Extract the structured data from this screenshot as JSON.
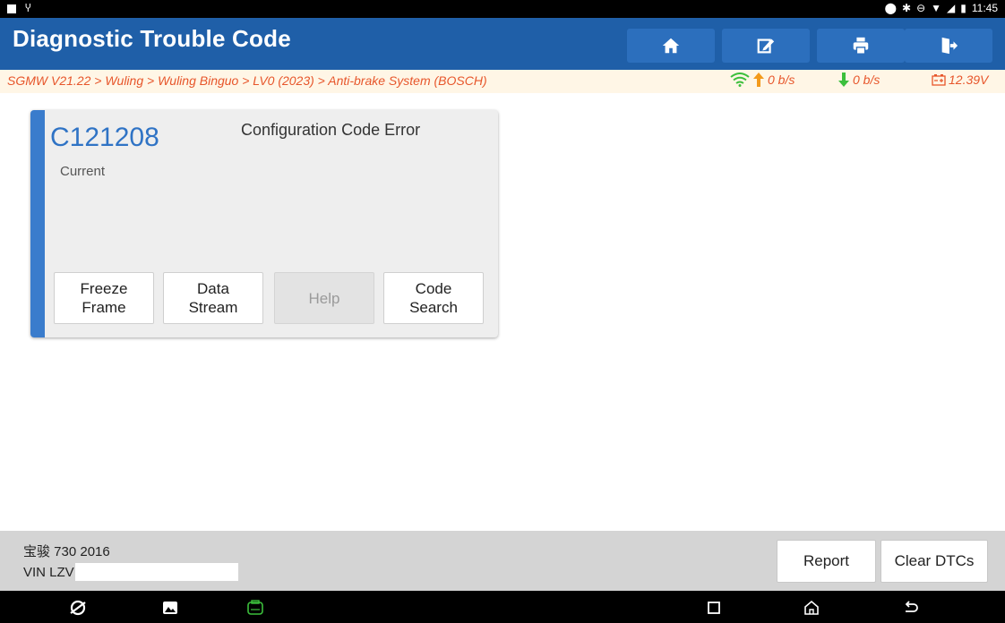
{
  "status_bar": {
    "time": "11:45",
    "left_icons": [
      "image-notification-icon",
      "usb-icon"
    ],
    "right_icons": [
      "location-icon",
      "bluetooth-icon",
      "dnd-icon",
      "wifi-icon",
      "signal-icon",
      "battery-icon"
    ]
  },
  "header": {
    "title": "Diagnostic Trouble Code",
    "buttons": [
      {
        "name": "home-button",
        "icon": "home-icon"
      },
      {
        "name": "edit-button",
        "icon": "edit-icon"
      },
      {
        "name": "print-button",
        "icon": "printer-icon"
      },
      {
        "name": "exit-button",
        "icon": "exit-icon"
      }
    ],
    "bg_color": "#1f5fa8"
  },
  "breadcrumb": {
    "path": "SGMW V21.22 > Wuling > Wuling Binguo > LV0 (2023) > Anti-brake System (BOSCH)",
    "upload_rate": "0 b/s",
    "download_rate": "0 b/s",
    "voltage": "12.39V",
    "text_color": "#e7562b"
  },
  "dtc": {
    "code": "C121208",
    "description": "Configuration Code Error",
    "status": "Current",
    "buttons": [
      {
        "label": "Freeze\nFrame",
        "enabled": true
      },
      {
        "label": "Data\nStream",
        "enabled": true
      },
      {
        "label": "Help",
        "enabled": false
      },
      {
        "label": "Code\nSearch",
        "enabled": true
      }
    ]
  },
  "footer": {
    "vehicle": "宝骏 730 2016",
    "vin_prefix": "VIN LZV",
    "report_label": "Report",
    "clear_label": "Clear DTCs"
  },
  "nav_bar": {
    "left_icons": [
      "browser-icon",
      "gallery-icon",
      "vci-icon"
    ],
    "right_icons": [
      "recents-icon",
      "home-icon",
      "back-icon"
    ]
  }
}
